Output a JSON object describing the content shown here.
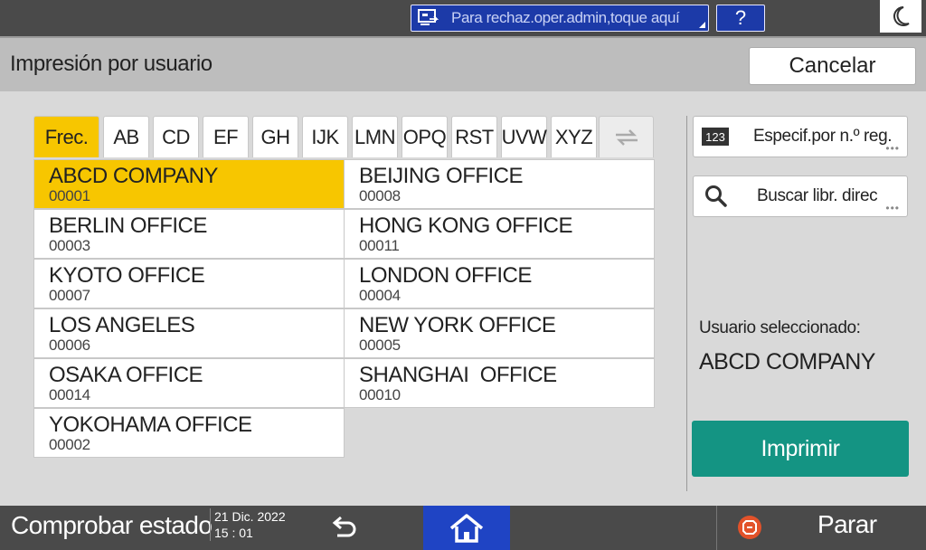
{
  "topbar": {
    "admin_text": "Para rechaz.oper.admin,toque aquí",
    "help_label": "?"
  },
  "header": {
    "title": "Impresión por usuario",
    "cancel_label": "Cancelar"
  },
  "tabs": [
    {
      "label": "Frec.",
      "active": true
    },
    {
      "label": "AB"
    },
    {
      "label": "CD"
    },
    {
      "label": "EF"
    },
    {
      "label": "GH"
    },
    {
      "label": "IJK"
    },
    {
      "label": "LMN"
    },
    {
      "label": "OPQ"
    },
    {
      "label": "RST"
    },
    {
      "label": "UVW"
    },
    {
      "label": "XYZ"
    }
  ],
  "entries": [
    {
      "name": "ABCD COMPANY",
      "number": "00001",
      "selected": true
    },
    {
      "name": "BEIJING OFFICE",
      "number": "00008"
    },
    {
      "name": "BERLIN OFFICE",
      "number": "00003"
    },
    {
      "name": "HONG KONG OFFICE",
      "number": "00011"
    },
    {
      "name": "KYOTO OFFICE",
      "number": "00007"
    },
    {
      "name": "LONDON OFFICE",
      "number": "00004"
    },
    {
      "name": "LOS ANGELES",
      "number": "00006"
    },
    {
      "name": "NEW YORK OFFICE",
      "number": "00005"
    },
    {
      "name": "OSAKA OFFICE",
      "number": "00014"
    },
    {
      "name": "SHANGHAI  OFFICE",
      "number": "00010"
    },
    {
      "name": "YOKOHAMA OFFICE",
      "number": "00002"
    }
  ],
  "side": {
    "reg_badge": "123",
    "reg_label": "Especif.por n.º reg.",
    "search_label": "Buscar libr. direc",
    "selected_label": "Usuario seleccionado:",
    "selected_value": "ABCD COMPANY",
    "print_label": "Imprimir"
  },
  "bottombar": {
    "status_label": "Comprobar estado",
    "date": "21 Dic. 2022",
    "time": "15 : 01",
    "stop_label": "Parar"
  },
  "colors": {
    "accent_yellow": "#f7c600",
    "print_green": "#149483",
    "home_blue": "#1f44c4",
    "admin_blue": "#1c3aa8"
  }
}
